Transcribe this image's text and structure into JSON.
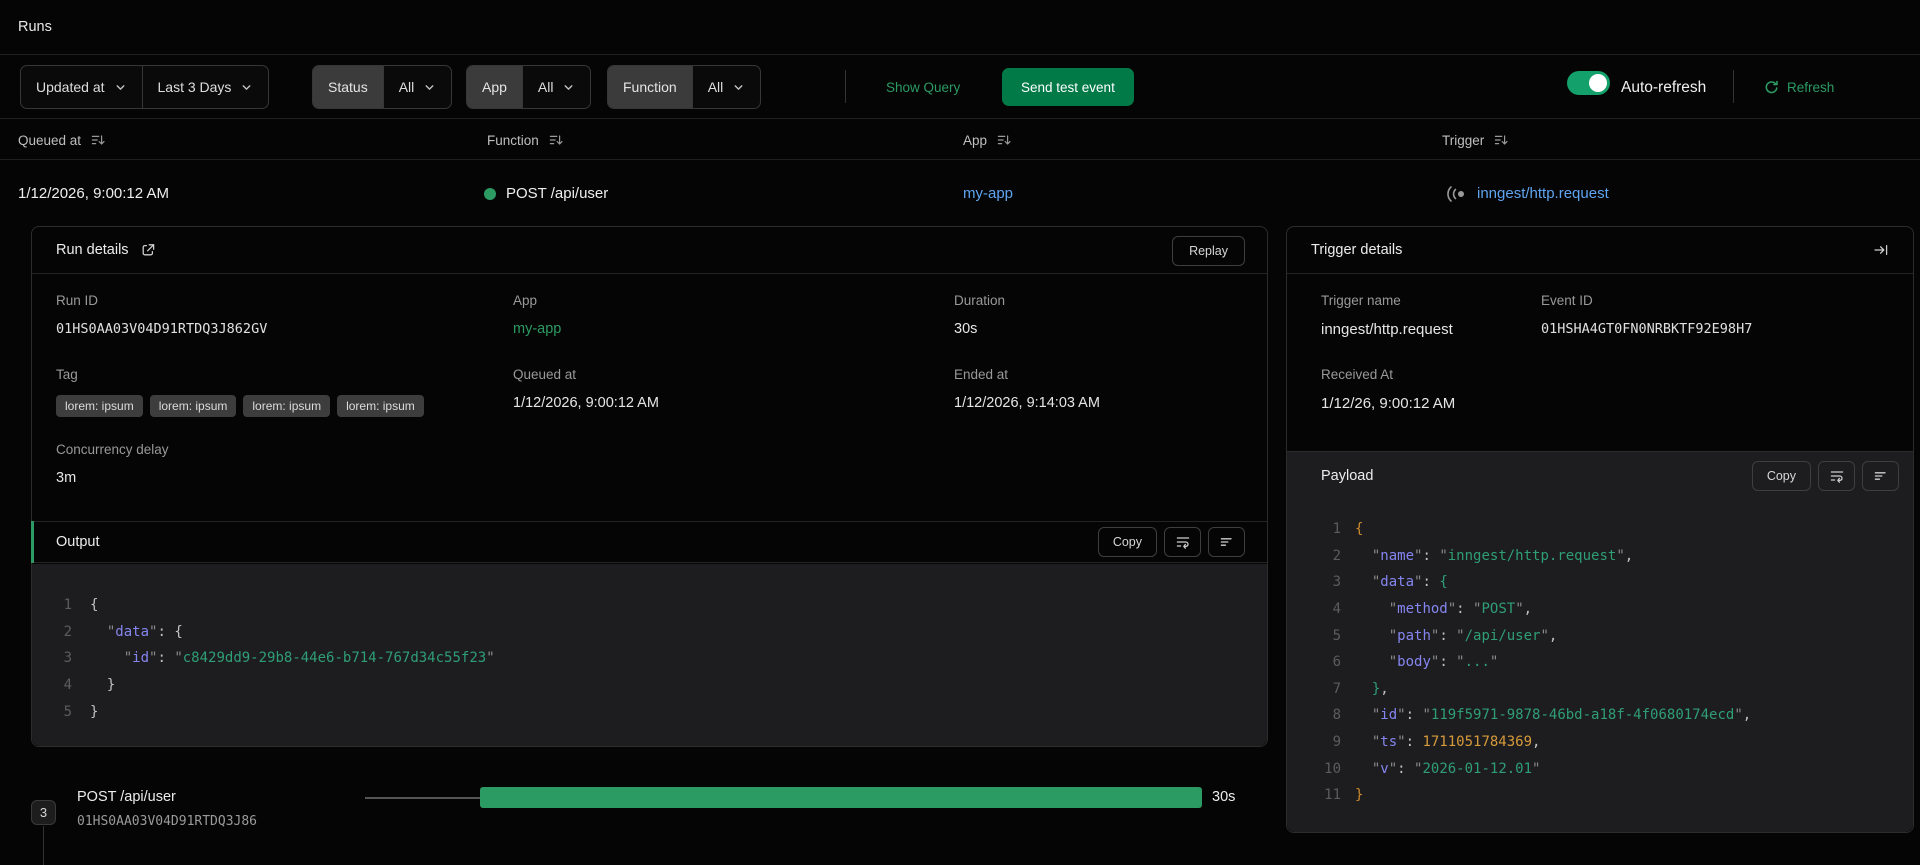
{
  "page": {
    "title": "Runs"
  },
  "colors": {
    "accent_green": "#2c9b63",
    "button_green": "#027a48",
    "link_blue": "#5fa4f0",
    "code_background": "#1d1d20"
  },
  "filter_bar": {
    "sort_field": {
      "label": "Updated at"
    },
    "time_range": {
      "label": "Last 3 Days"
    },
    "status_filter": {
      "label": "Status",
      "value": "All"
    },
    "app_filter": {
      "label": "App",
      "value": "All"
    },
    "function_filter": {
      "label": "Function",
      "value": "All"
    },
    "show_query_label": "Show Query",
    "send_test_event_label": "Send test event",
    "auto_refresh_label": "Auto-refresh",
    "auto_refresh_enabled": true,
    "refresh_label": "Refresh"
  },
  "runs_table": {
    "columns": [
      "Queued at",
      "Function",
      "App",
      "Trigger"
    ],
    "row": {
      "queued_at": "1/12/2026, 9:00:12 AM",
      "function_name": "POST /api/user",
      "app": "my-app",
      "trigger": "inngest/http.request"
    }
  },
  "run_details": {
    "title": "Run details",
    "replay_label": "Replay",
    "run_id": {
      "label": "Run ID",
      "value": "01HS0AA03V04D91RTDQ3J862GV"
    },
    "app": {
      "label": "App",
      "value": "my-app"
    },
    "duration": {
      "label": "Duration",
      "value": "30s"
    },
    "tag": {
      "label": "Tag",
      "values": [
        "lorem: ipsum",
        "lorem: ipsum",
        "lorem: ipsum",
        "lorem: ipsum"
      ]
    },
    "queued_at": {
      "label": "Queued at",
      "value": "1/12/2026, 9:00:12 AM"
    },
    "ended_at": {
      "label": "Ended at",
      "value": "1/12/2026, 9:14:03 AM"
    },
    "concurrency_delay": {
      "label": "Concurrency delay",
      "value": "3m"
    },
    "output": {
      "title": "Output",
      "copy_label": "Copy",
      "lines": [
        {
          "n": "1",
          "parts": [
            [
              "{",
              "p"
            ]
          ]
        },
        {
          "n": "2",
          "parts": [
            [
              "  ",
              "p"
            ],
            [
              "\"",
              "q"
            ],
            [
              "data",
              "k"
            ],
            [
              "\"",
              "q"
            ],
            [
              ": ",
              "p"
            ],
            [
              "{",
              "p"
            ]
          ]
        },
        {
          "n": "3",
          "parts": [
            [
              "    ",
              "p"
            ],
            [
              "\"",
              "q"
            ],
            [
              "id",
              "k"
            ],
            [
              "\"",
              "q"
            ],
            [
              ": ",
              "p"
            ],
            [
              "\"",
              "q"
            ],
            [
              "c8429dd9-29b8-44e6-b714-767d34c55f23",
              "s"
            ],
            [
              "\"",
              "q"
            ]
          ]
        },
        {
          "n": "4",
          "parts": [
            [
              "  ",
              "p"
            ],
            [
              "}",
              "p"
            ]
          ]
        },
        {
          "n": "5",
          "parts": [
            [
              "}",
              "p"
            ]
          ]
        }
      ]
    }
  },
  "trigger_details": {
    "title": "Trigger details",
    "trigger_name": {
      "label": "Trigger name",
      "value": "inngest/http.request"
    },
    "event_id": {
      "label": "Event ID",
      "value": "01HSHA4GT0FN0NRBKTF92E98H7"
    },
    "received_at": {
      "label": "Received At",
      "value": "1/12/26, 9:00:12 AM"
    },
    "payload": {
      "title": "Payload",
      "copy_label": "Copy",
      "lines": [
        {
          "n": "1",
          "parts": [
            [
              "{",
              "bo"
            ]
          ]
        },
        {
          "n": "2",
          "parts": [
            [
              "  ",
              "p"
            ],
            [
              "\"",
              "q"
            ],
            [
              "name",
              "k"
            ],
            [
              "\"",
              "q"
            ],
            [
              ": ",
              "p"
            ],
            [
              "\"",
              "q"
            ],
            [
              "inngest/http.request",
              "s"
            ],
            [
              "\"",
              "q"
            ],
            [
              ",",
              "p"
            ]
          ]
        },
        {
          "n": "3",
          "parts": [
            [
              "  ",
              "p"
            ],
            [
              "\"",
              "q"
            ],
            [
              "data",
              "k"
            ],
            [
              "\"",
              "q"
            ],
            [
              ": ",
              "p"
            ],
            [
              "{",
              "bg"
            ]
          ]
        },
        {
          "n": "4",
          "parts": [
            [
              "    ",
              "p"
            ],
            [
              "\"",
              "q"
            ],
            [
              "method",
              "k"
            ],
            [
              "\"",
              "q"
            ],
            [
              ": ",
              "p"
            ],
            [
              "\"",
              "q"
            ],
            [
              "POST",
              "s"
            ],
            [
              "\"",
              "q"
            ],
            [
              ",",
              "p"
            ]
          ]
        },
        {
          "n": "5",
          "parts": [
            [
              "    ",
              "p"
            ],
            [
              "\"",
              "q"
            ],
            [
              "path",
              "k"
            ],
            [
              "\"",
              "q"
            ],
            [
              ": ",
              "p"
            ],
            [
              "\"",
              "q"
            ],
            [
              "/api/user",
              "s"
            ],
            [
              "\"",
              "q"
            ],
            [
              ",",
              "p"
            ]
          ]
        },
        {
          "n": "6",
          "parts": [
            [
              "    ",
              "p"
            ],
            [
              "\"",
              "q"
            ],
            [
              "body",
              "k"
            ],
            [
              "\"",
              "q"
            ],
            [
              ": ",
              "p"
            ],
            [
              "\"",
              "q"
            ],
            [
              "...",
              "s"
            ],
            [
              "\"",
              "q"
            ]
          ]
        },
        {
          "n": "7",
          "parts": [
            [
              "  ",
              "p"
            ],
            [
              "}",
              "bg"
            ],
            [
              ",",
              "p"
            ]
          ]
        },
        {
          "n": "8",
          "parts": [
            [
              "  ",
              "p"
            ],
            [
              "\"",
              "q"
            ],
            [
              "id",
              "k"
            ],
            [
              "\"",
              "q"
            ],
            [
              ": ",
              "p"
            ],
            [
              "\"",
              "q"
            ],
            [
              "119f5971-9878-46bd-a18f-4f0680174ecd",
              "s"
            ],
            [
              "\"",
              "q"
            ],
            [
              ",",
              "p"
            ]
          ]
        },
        {
          "n": "9",
          "parts": [
            [
              "  ",
              "p"
            ],
            [
              "\"",
              "q"
            ],
            [
              "ts",
              "k"
            ],
            [
              "\"",
              "q"
            ],
            [
              ": ",
              "p"
            ],
            [
              "1711051784369",
              "n"
            ],
            [
              ",",
              "p"
            ]
          ]
        },
        {
          "n": "10",
          "parts": [
            [
              "  ",
              "p"
            ],
            [
              "\"",
              "q"
            ],
            [
              "v",
              "k"
            ],
            [
              "\"",
              "q"
            ],
            [
              ": ",
              "p"
            ],
            [
              "\"",
              "q"
            ],
            [
              "2026-01-12.01",
              "s"
            ],
            [
              "\"",
              "q"
            ]
          ]
        },
        {
          "n": "11",
          "parts": [
            [
              "}",
              "bo"
            ]
          ]
        }
      ]
    }
  },
  "timeline": {
    "step_count": "3",
    "step_name": "POST /api/user",
    "step_run_id": "01HS0AA03V04D91RTDQ3J86",
    "duration": "30s"
  }
}
